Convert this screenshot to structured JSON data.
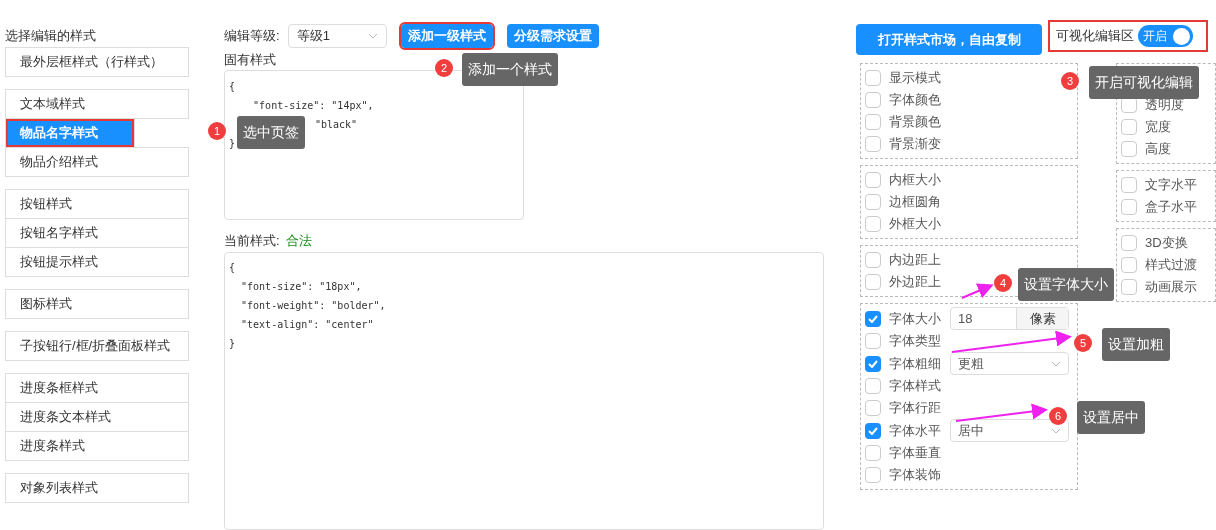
{
  "sidebar": {
    "title": "选择编辑的样式",
    "groups": [
      [
        {
          "label": "最外层框样式（行样式）",
          "selected": false,
          "highlighted": false
        }
      ],
      [
        {
          "label": "文本域样式",
          "selected": false,
          "highlighted": false
        },
        {
          "label": "物品名字样式",
          "selected": true,
          "highlighted": true
        },
        {
          "label": "物品介绍样式",
          "selected": false,
          "highlighted": false
        }
      ],
      [
        {
          "label": "按钮样式",
          "selected": false,
          "highlighted": false
        },
        {
          "label": "按钮名字样式",
          "selected": false,
          "highlighted": false
        },
        {
          "label": "按钮提示样式",
          "selected": false,
          "highlighted": false
        }
      ],
      [
        {
          "label": "图标样式",
          "selected": false,
          "highlighted": false
        }
      ],
      [
        {
          "label": "子按钮行/框/折叠面板样式",
          "selected": false,
          "highlighted": false
        }
      ],
      [
        {
          "label": "进度条框样式",
          "selected": false,
          "highlighted": false
        },
        {
          "label": "进度条文本样式",
          "selected": false,
          "highlighted": false
        },
        {
          "label": "进度条样式",
          "selected": false,
          "highlighted": false
        }
      ],
      [
        {
          "label": "对象列表样式",
          "selected": false,
          "highlighted": false
        }
      ]
    ]
  },
  "editor": {
    "level_label": "编辑等级:",
    "level_value": "等级1",
    "buttons": [
      {
        "label": "添加一级样式",
        "highlighted": true
      },
      {
        "label": "分级需求设置",
        "highlighted": false
      }
    ],
    "fixed_label": "固有样式",
    "fixed_lines": [
      "{",
      "    \"font-size\": \"14px\",",
      "\"black\"",
      "}"
    ],
    "current_label": "当前样式:",
    "current_status": "合法",
    "current_lines": [
      "{",
      "  \"font-size\": \"18px\",",
      "  \"font-weight\": \"bolder\",",
      "  \"text-align\": \"center\"",
      "}"
    ]
  },
  "market_button": "打开样式市场，自由复制",
  "visual_edit": {
    "label": "可视化编辑区",
    "toggle_text": "开启",
    "on": true,
    "highlighted": true
  },
  "options_left": [
    [
      {
        "label": "显示模式",
        "checked": false
      },
      {
        "label": "字体颜色",
        "checked": false
      },
      {
        "label": "背景颜色",
        "checked": false
      },
      {
        "label": "背景渐变",
        "checked": false
      }
    ],
    [
      {
        "label": "内框大小",
        "checked": false
      },
      {
        "label": "边框圆角",
        "checked": false
      },
      {
        "label": "外框大小",
        "checked": false
      }
    ],
    [
      {
        "label": "内边距上",
        "checked": false
      },
      {
        "label": "外边距上",
        "checked": false
      }
    ],
    [
      {
        "label": "字体大小",
        "checked": true,
        "kind": "number",
        "value": "18",
        "unit": "像素"
      },
      {
        "label": "字体类型",
        "checked": false,
        "kind": "plain"
      },
      {
        "label": "字体粗细",
        "checked": true,
        "kind": "select",
        "value": "更粗"
      },
      {
        "label": "字体样式",
        "checked": false,
        "kind": "plain"
      },
      {
        "label": "字体行距",
        "checked": false,
        "kind": "plain"
      },
      {
        "label": "字体水平",
        "checked": true,
        "kind": "select",
        "value": "居中"
      },
      {
        "label": "字体垂直",
        "checked": false,
        "kind": "plain"
      },
      {
        "label": "字体装饰",
        "checked": false,
        "kind": "plain"
      }
    ]
  ],
  "options_right": [
    [
      {
        "label": "透明度",
        "checked": false
      },
      {
        "label": "宽度",
        "checked": false
      },
      {
        "label": "高度",
        "checked": false
      }
    ],
    [
      {
        "label": "文字水平",
        "checked": false
      },
      {
        "label": "盒子水平",
        "checked": false
      }
    ],
    [
      {
        "label": "3D变换",
        "checked": false
      },
      {
        "label": "样式过渡",
        "checked": false
      },
      {
        "label": "动画展示",
        "checked": false
      }
    ]
  ],
  "annotations": [
    {
      "number": "1",
      "text": "选中页签"
    },
    {
      "number": "2",
      "text": "添加一个样式"
    },
    {
      "number": "3",
      "text": "开启可视化编辑"
    },
    {
      "number": "4",
      "text": "设置字体大小"
    },
    {
      "number": "5",
      "text": "设置加粗"
    },
    {
      "number": "6",
      "text": "设置居中"
    }
  ]
}
